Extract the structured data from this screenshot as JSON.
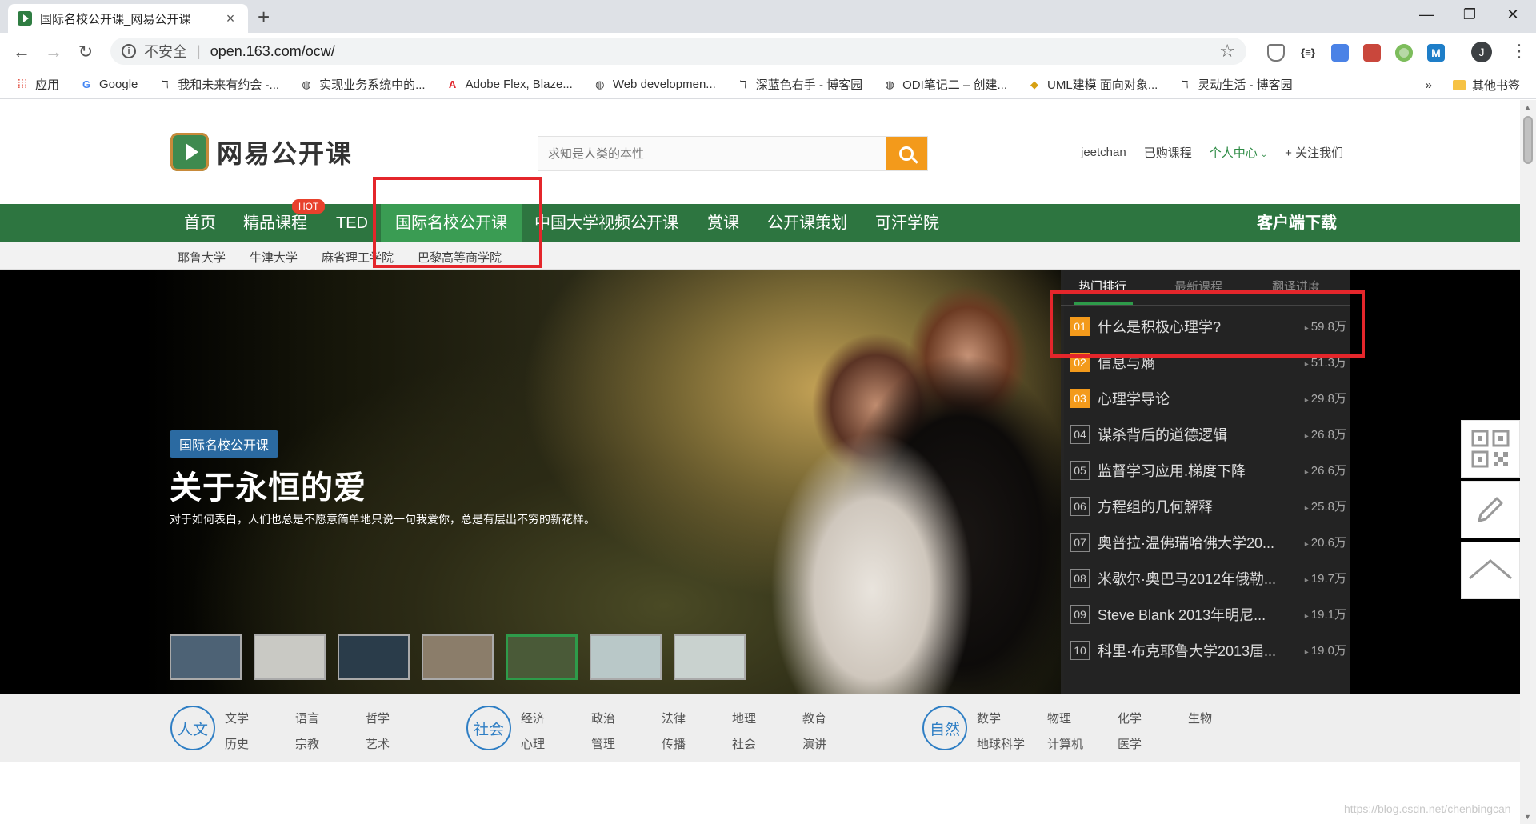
{
  "browser": {
    "tab_title": "国际名校公开课_网易公开课",
    "tab_close": "×",
    "new_tab": "+",
    "window_controls": [
      "—",
      "❐",
      "✕"
    ],
    "insecure_label": "不安全",
    "url": "open.163.com/ocw/",
    "avatar_letter": "J",
    "bookmarks": [
      {
        "label": "应用",
        "icon": "apps-grid-icon"
      },
      {
        "label": "Google",
        "icon": "google-g-icon"
      },
      {
        "label": "我和未来有约会 -...",
        "icon": "bird-icon"
      },
      {
        "label": "实现业务系统中的...",
        "icon": "globe-icon"
      },
      {
        "label": "Adobe Flex, Blaze...",
        "icon": "adobe-icon"
      },
      {
        "label": "Web developmen...",
        "icon": "globe-icon"
      },
      {
        "label": "深蓝色右手 - 博客园",
        "icon": "bird-icon"
      },
      {
        "label": "ODI笔记二 – 创建...",
        "icon": "globe-icon"
      },
      {
        "label": "UML建模 面向对象...",
        "icon": "cube-icon"
      },
      {
        "label": "灵动生活 - 博客园",
        "icon": "bird-icon"
      }
    ],
    "bookmarks_more": "»",
    "other_bookmarks": "其他书签"
  },
  "header": {
    "logo_text": "网易公开课",
    "search_placeholder": "求知是人类的本性",
    "username": "jeetchan",
    "purchased": "已购课程",
    "personal_center": "个人中心",
    "follow_us": "+ 关注我们"
  },
  "nav": {
    "items": [
      "首页",
      "精品课程",
      "TED",
      "国际名校公开课",
      "中国大学视频公开课",
      "赏课",
      "公开课策划",
      "可汗学院"
    ],
    "hot_badge": "HOT",
    "download": "客户端下载",
    "active_index": 3
  },
  "subnav": {
    "items": [
      "耶鲁大学",
      "牛津大学",
      "麻省理工学院",
      "巴黎高等商学院"
    ]
  },
  "hero": {
    "tag": "国际名校公开课",
    "title": "关于永恒的爱",
    "description": "对于如何表白，人们也总是不愿意简单地只说一句我爱你，总是有层出不穷的新花样。",
    "active_thumb_index": 4,
    "thumb_colors": [
      "#4d6275",
      "#c9c9c4",
      "#2a3c4a",
      "#8b7d6a",
      "#4a5a38",
      "#b9c8c8",
      "#c9d2cf"
    ]
  },
  "ranking": {
    "tabs": [
      "热门排行",
      "最新课程",
      "翻译进度"
    ],
    "items": [
      {
        "num": "01",
        "title": "什么是积极心理学?",
        "count": "59.8万"
      },
      {
        "num": "02",
        "title": "信息与熵",
        "count": "51.3万"
      },
      {
        "num": "03",
        "title": "心理学导论",
        "count": "29.8万"
      },
      {
        "num": "04",
        "title": "谋杀背后的道德逻辑",
        "count": "26.8万"
      },
      {
        "num": "05",
        "title": "监督学习应用.梯度下降",
        "count": "26.6万"
      },
      {
        "num": "06",
        "title": "方程组的几何解释",
        "count": "25.8万"
      },
      {
        "num": "07",
        "title": "奥普拉·温佛瑞哈佛大学20...",
        "count": "20.6万"
      },
      {
        "num": "08",
        "title": "米歇尔·奥巴马2012年俄勒...",
        "count": "19.7万"
      },
      {
        "num": "09",
        "title": "Steve Blank 2013年明尼...",
        "count": "19.1万"
      },
      {
        "num": "10",
        "title": "科里·布克耶鲁大学2013届...",
        "count": "19.0万"
      }
    ]
  },
  "categories": {
    "groups": [
      {
        "name": "人文",
        "links": [
          [
            "文学",
            "历史"
          ],
          [
            "语言",
            "宗教"
          ],
          [
            "哲学",
            "艺术"
          ]
        ]
      },
      {
        "name": "社会",
        "links": [
          [
            "经济",
            "心理"
          ],
          [
            "政治",
            "管理"
          ],
          [
            "法律",
            "传播"
          ],
          [
            "地理",
            "社会"
          ],
          [
            "教育",
            "演讲"
          ]
        ]
      },
      {
        "name": "自然",
        "links": [
          [
            "数学",
            "地球科学"
          ],
          [
            "物理",
            "计算机"
          ],
          [
            "化学",
            "医学"
          ],
          [
            "生物",
            ""
          ]
        ]
      }
    ]
  },
  "watermark": "https://blog.csdn.net/chenbingcan",
  "colors": {
    "nav_green": "#2d7540",
    "active_green": "#3a9c53",
    "search_orange": "#f39a1b",
    "highlight_red": "#e4262b",
    "category_blue": "#2e7ec4"
  }
}
